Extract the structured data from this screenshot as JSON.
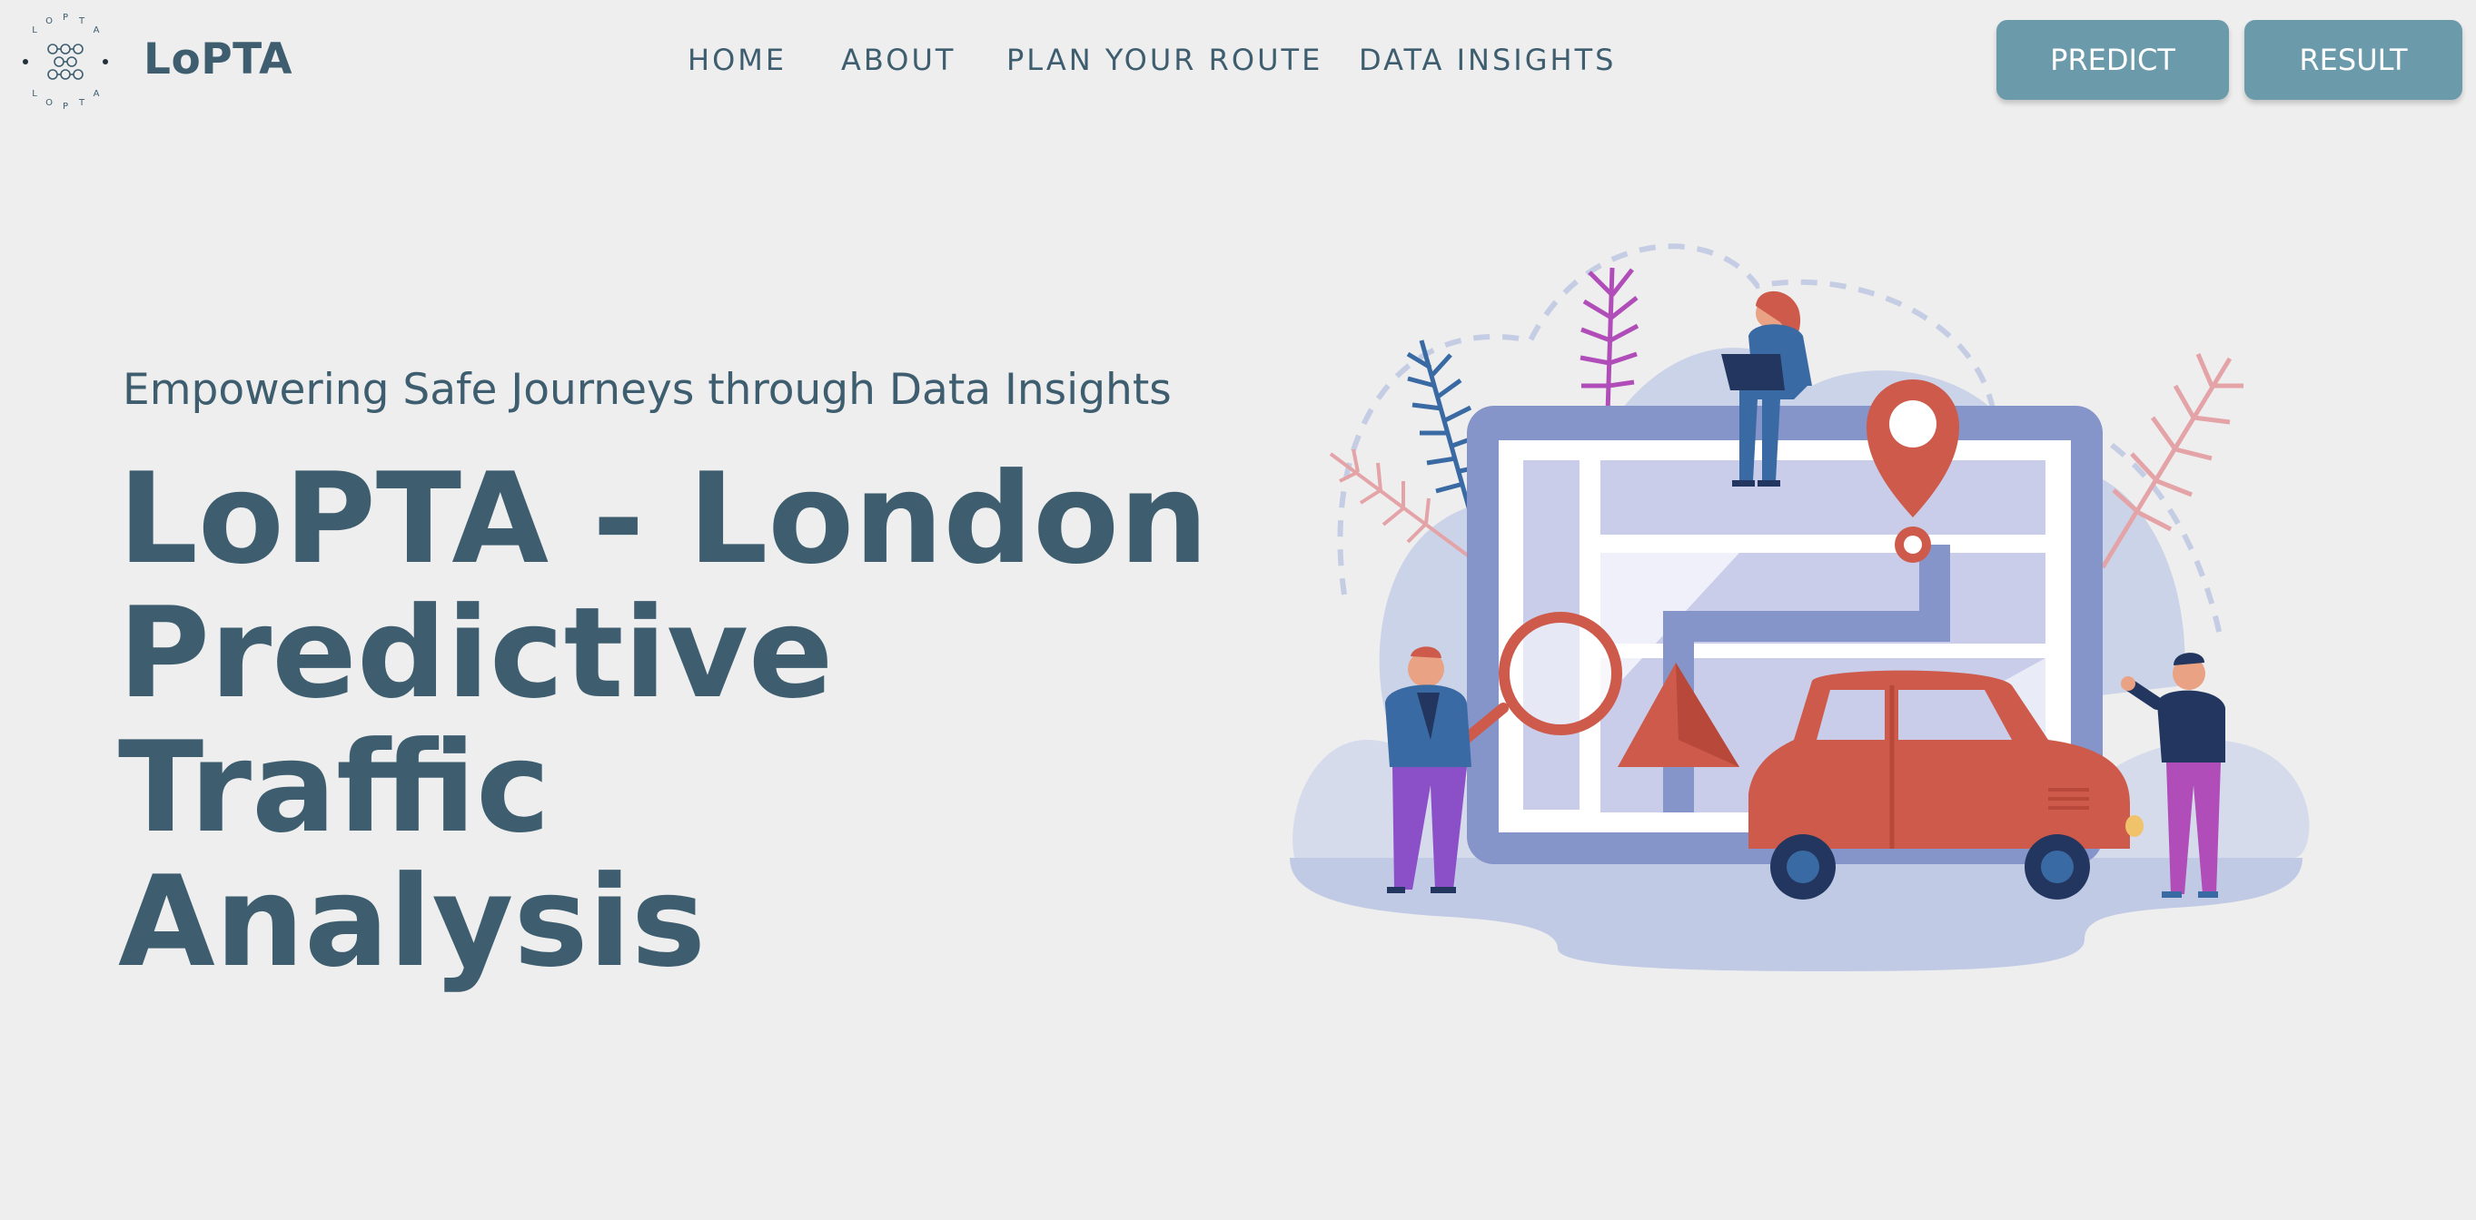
{
  "brand": {
    "name": "LoPTA",
    "logo_ring_text": "L O P T A"
  },
  "nav": {
    "items": [
      {
        "label": "HOME"
      },
      {
        "label": "ABOUT"
      },
      {
        "label": "PLAN YOUR ROUTE"
      },
      {
        "label": "DATA INSIGHTS"
      }
    ]
  },
  "actions": {
    "predict_label": "PREDICT",
    "result_label": "RESULT"
  },
  "hero": {
    "subtitle": "Empowering Safe Journeys through Data Insights",
    "title_line1": "LoPTA - London",
    "title_line2": "Predictive Traffic",
    "title_line3": "Analysis"
  },
  "colors": {
    "background": "#eeeeee",
    "text": "#3e5e70",
    "button": "#6b9bab",
    "map_frame": "#8594c9",
    "accent_red": "#cd5a4a"
  }
}
